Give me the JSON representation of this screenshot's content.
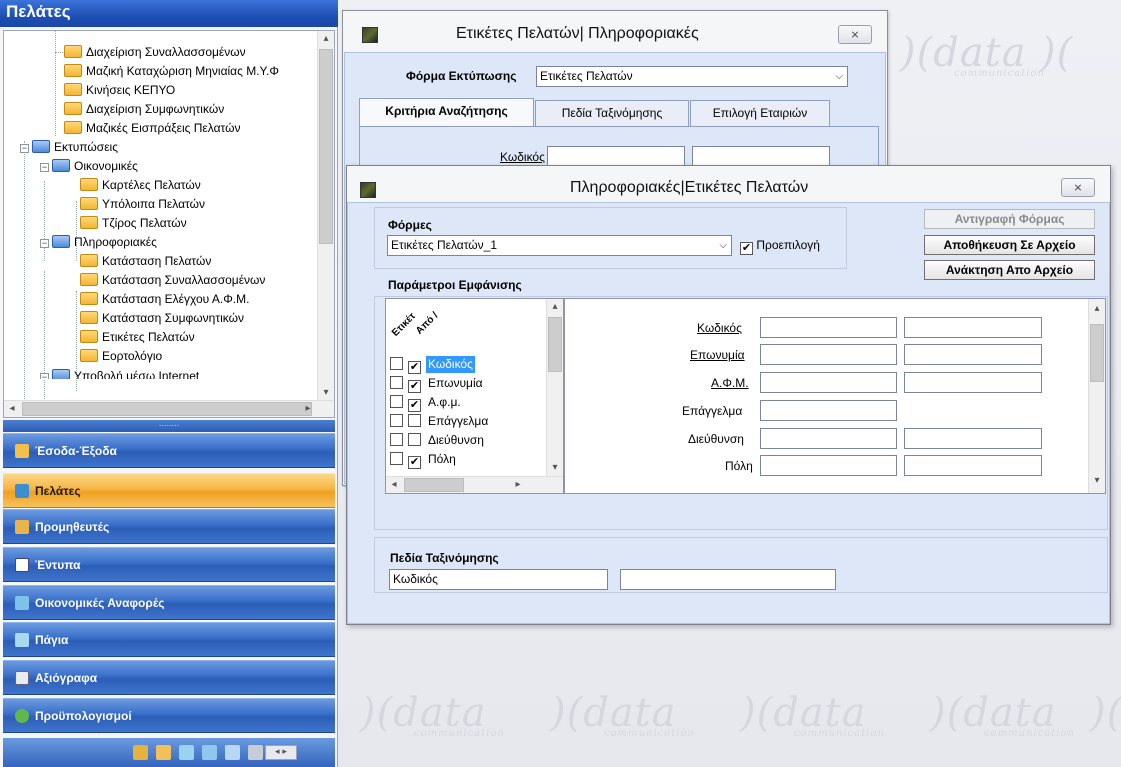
{
  "watermark": {
    "text": "data",
    "subtext": "communication"
  },
  "left_panel": {
    "title": "Πελάτες",
    "tree": [
      {
        "label": "Διαχείριση Συναλλασσομένων",
        "type": "leaf"
      },
      {
        "label": "Μαζική Καταχώριση Μηνιαίας Μ.Υ.Φ",
        "type": "leaf"
      },
      {
        "label": "Κινήσεις ΚΕΠΥΟ",
        "type": "leaf"
      },
      {
        "label": "Διαχείριση Συμφωνητικών",
        "type": "leaf"
      },
      {
        "label": "Μαζικές Εισπράξεις Πελατών",
        "type": "leaf"
      },
      {
        "label": "Εκτυπώσεις",
        "type": "group"
      },
      {
        "label": "Οικονομικές",
        "type": "group"
      },
      {
        "label": "Καρτέλες Πελατών",
        "type": "leaf"
      },
      {
        "label": "Υπόλοιπα Πελατών",
        "type": "leaf"
      },
      {
        "label": "Τζίρος Πελατών",
        "type": "leaf"
      },
      {
        "label": "Πληροφοριακές",
        "type": "group"
      },
      {
        "label": "Κατάσταση Πελατών",
        "type": "leaf"
      },
      {
        "label": "Κατάσταση Συναλλασσομένων",
        "type": "leaf"
      },
      {
        "label": "Κατάσταση Ελέγχου Α.Φ.Μ.",
        "type": "leaf"
      },
      {
        "label": "Κατάσταση Συμφωνητικών",
        "type": "leaf"
      },
      {
        "label": "Ετικέτες Πελατών",
        "type": "leaf"
      },
      {
        "label": "Εορτολόγιο",
        "type": "leaf"
      },
      {
        "label": "Υποβολή μέσω Internet",
        "type": "group"
      }
    ],
    "nav": [
      {
        "label": "Έσοδα-Έξοδα",
        "active": false,
        "icon": "money-icon"
      },
      {
        "label": "Πελάτες",
        "active": true,
        "icon": "customers-icon"
      },
      {
        "label": "Προμηθευτές",
        "active": false,
        "icon": "suppliers-icon"
      },
      {
        "label": "Έντυπα",
        "active": false,
        "icon": "forms-icon"
      },
      {
        "label": "Οικονομικές Αναφορές",
        "active": false,
        "icon": "reports-icon"
      },
      {
        "label": "Πάγια",
        "active": false,
        "icon": "assets-icon"
      },
      {
        "label": "Αξιόγραφα",
        "active": false,
        "icon": "checks-icon"
      },
      {
        "label": "Προϋπολογισμοί",
        "active": false,
        "icon": "budget-icon"
      }
    ]
  },
  "window1": {
    "title": "Ετικέτες Πελατών| Πληροφοριακές",
    "close_label": "⨯",
    "print_form_label": "Φόρμα Εκτύπωσης",
    "print_form_value": "Ετικέτες Πελατών",
    "tabs": [
      "Κριτήρια Αναζήτησης",
      "Πεδία Ταξινόμησης",
      "Επιλογή Εταιριών"
    ],
    "code_label": "Κωδικός"
  },
  "window2": {
    "title": "Πληροφοριακές|Ετικέτες Πελατών",
    "close_label": "⨯",
    "forms_label": "Φόρμες",
    "forms_value": "Ετικέτες Πελατών_1",
    "default_label": "Προεπιλογή",
    "copy_form_button": "Αντιγραφή Φόρμας",
    "save_file_button": "Αποθήκευση Σε Αρχείο",
    "load_file_button": "Ανάκτηση Απο Αρχείο",
    "display_params_label": "Παράμετροι Εμφάνισης",
    "list_header_1": "Ετικέτ",
    "list_header_2": "Από /",
    "params": [
      {
        "label": "Κωδικός",
        "c1": false,
        "c2": true,
        "selected": true
      },
      {
        "label": "Επωνυμία",
        "c1": false,
        "c2": true,
        "selected": false
      },
      {
        "label": "Α.φ.μ.",
        "c1": false,
        "c2": true,
        "selected": false
      },
      {
        "label": "Επάγγελμα",
        "c1": false,
        "c2": false,
        "selected": false
      },
      {
        "label": "Διεύθυνση",
        "c1": false,
        "c2": false,
        "selected": false
      },
      {
        "label": "Πόλη",
        "c1": false,
        "c2": true,
        "selected": false
      }
    ],
    "fields": [
      {
        "label": "Κωδικός",
        "underline": true,
        "two": true
      },
      {
        "label": "Επωνυμία",
        "underline": true,
        "two": true
      },
      {
        "label": "Α.Φ.Μ.",
        "underline": true,
        "two": true
      },
      {
        "label": "Επάγγελμα",
        "underline": false,
        "two": false
      },
      {
        "label": "Διεύθυνση",
        "underline": false,
        "two": true
      },
      {
        "label": "Πόλη",
        "underline": false,
        "two": true
      }
    ],
    "sort_fields_label": "Πεδία Ταξινόμησης",
    "sort_field_1": "Κωδικός",
    "sort_field_2": ""
  }
}
